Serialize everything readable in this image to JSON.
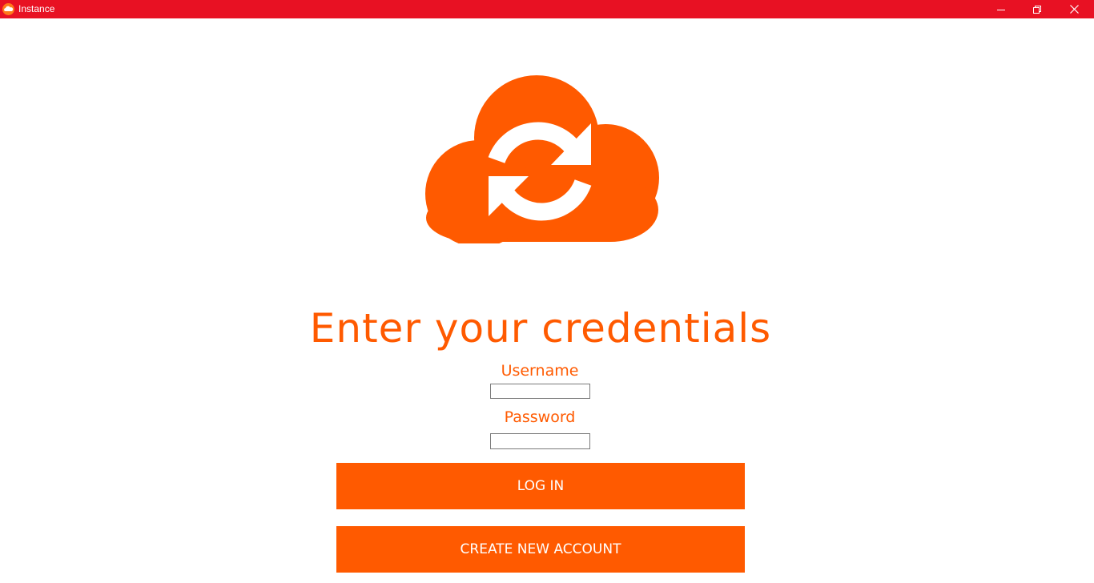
{
  "window": {
    "title": "Instance",
    "controls": {
      "minimize": "minimize-icon",
      "maximize": "restore-icon",
      "close": "close-icon"
    }
  },
  "colors": {
    "titlebar": "#e81123",
    "accent": "#ff5a00",
    "background": "#ffffff"
  },
  "logo": {
    "icon": "cloud-sync-icon"
  },
  "form": {
    "heading": "Enter your credentials",
    "username_label": "Username",
    "username_value": "",
    "password_label": "Password",
    "password_value": "",
    "login_button": "LOG IN",
    "create_account_button": "CREATE NEW ACCOUNT"
  }
}
